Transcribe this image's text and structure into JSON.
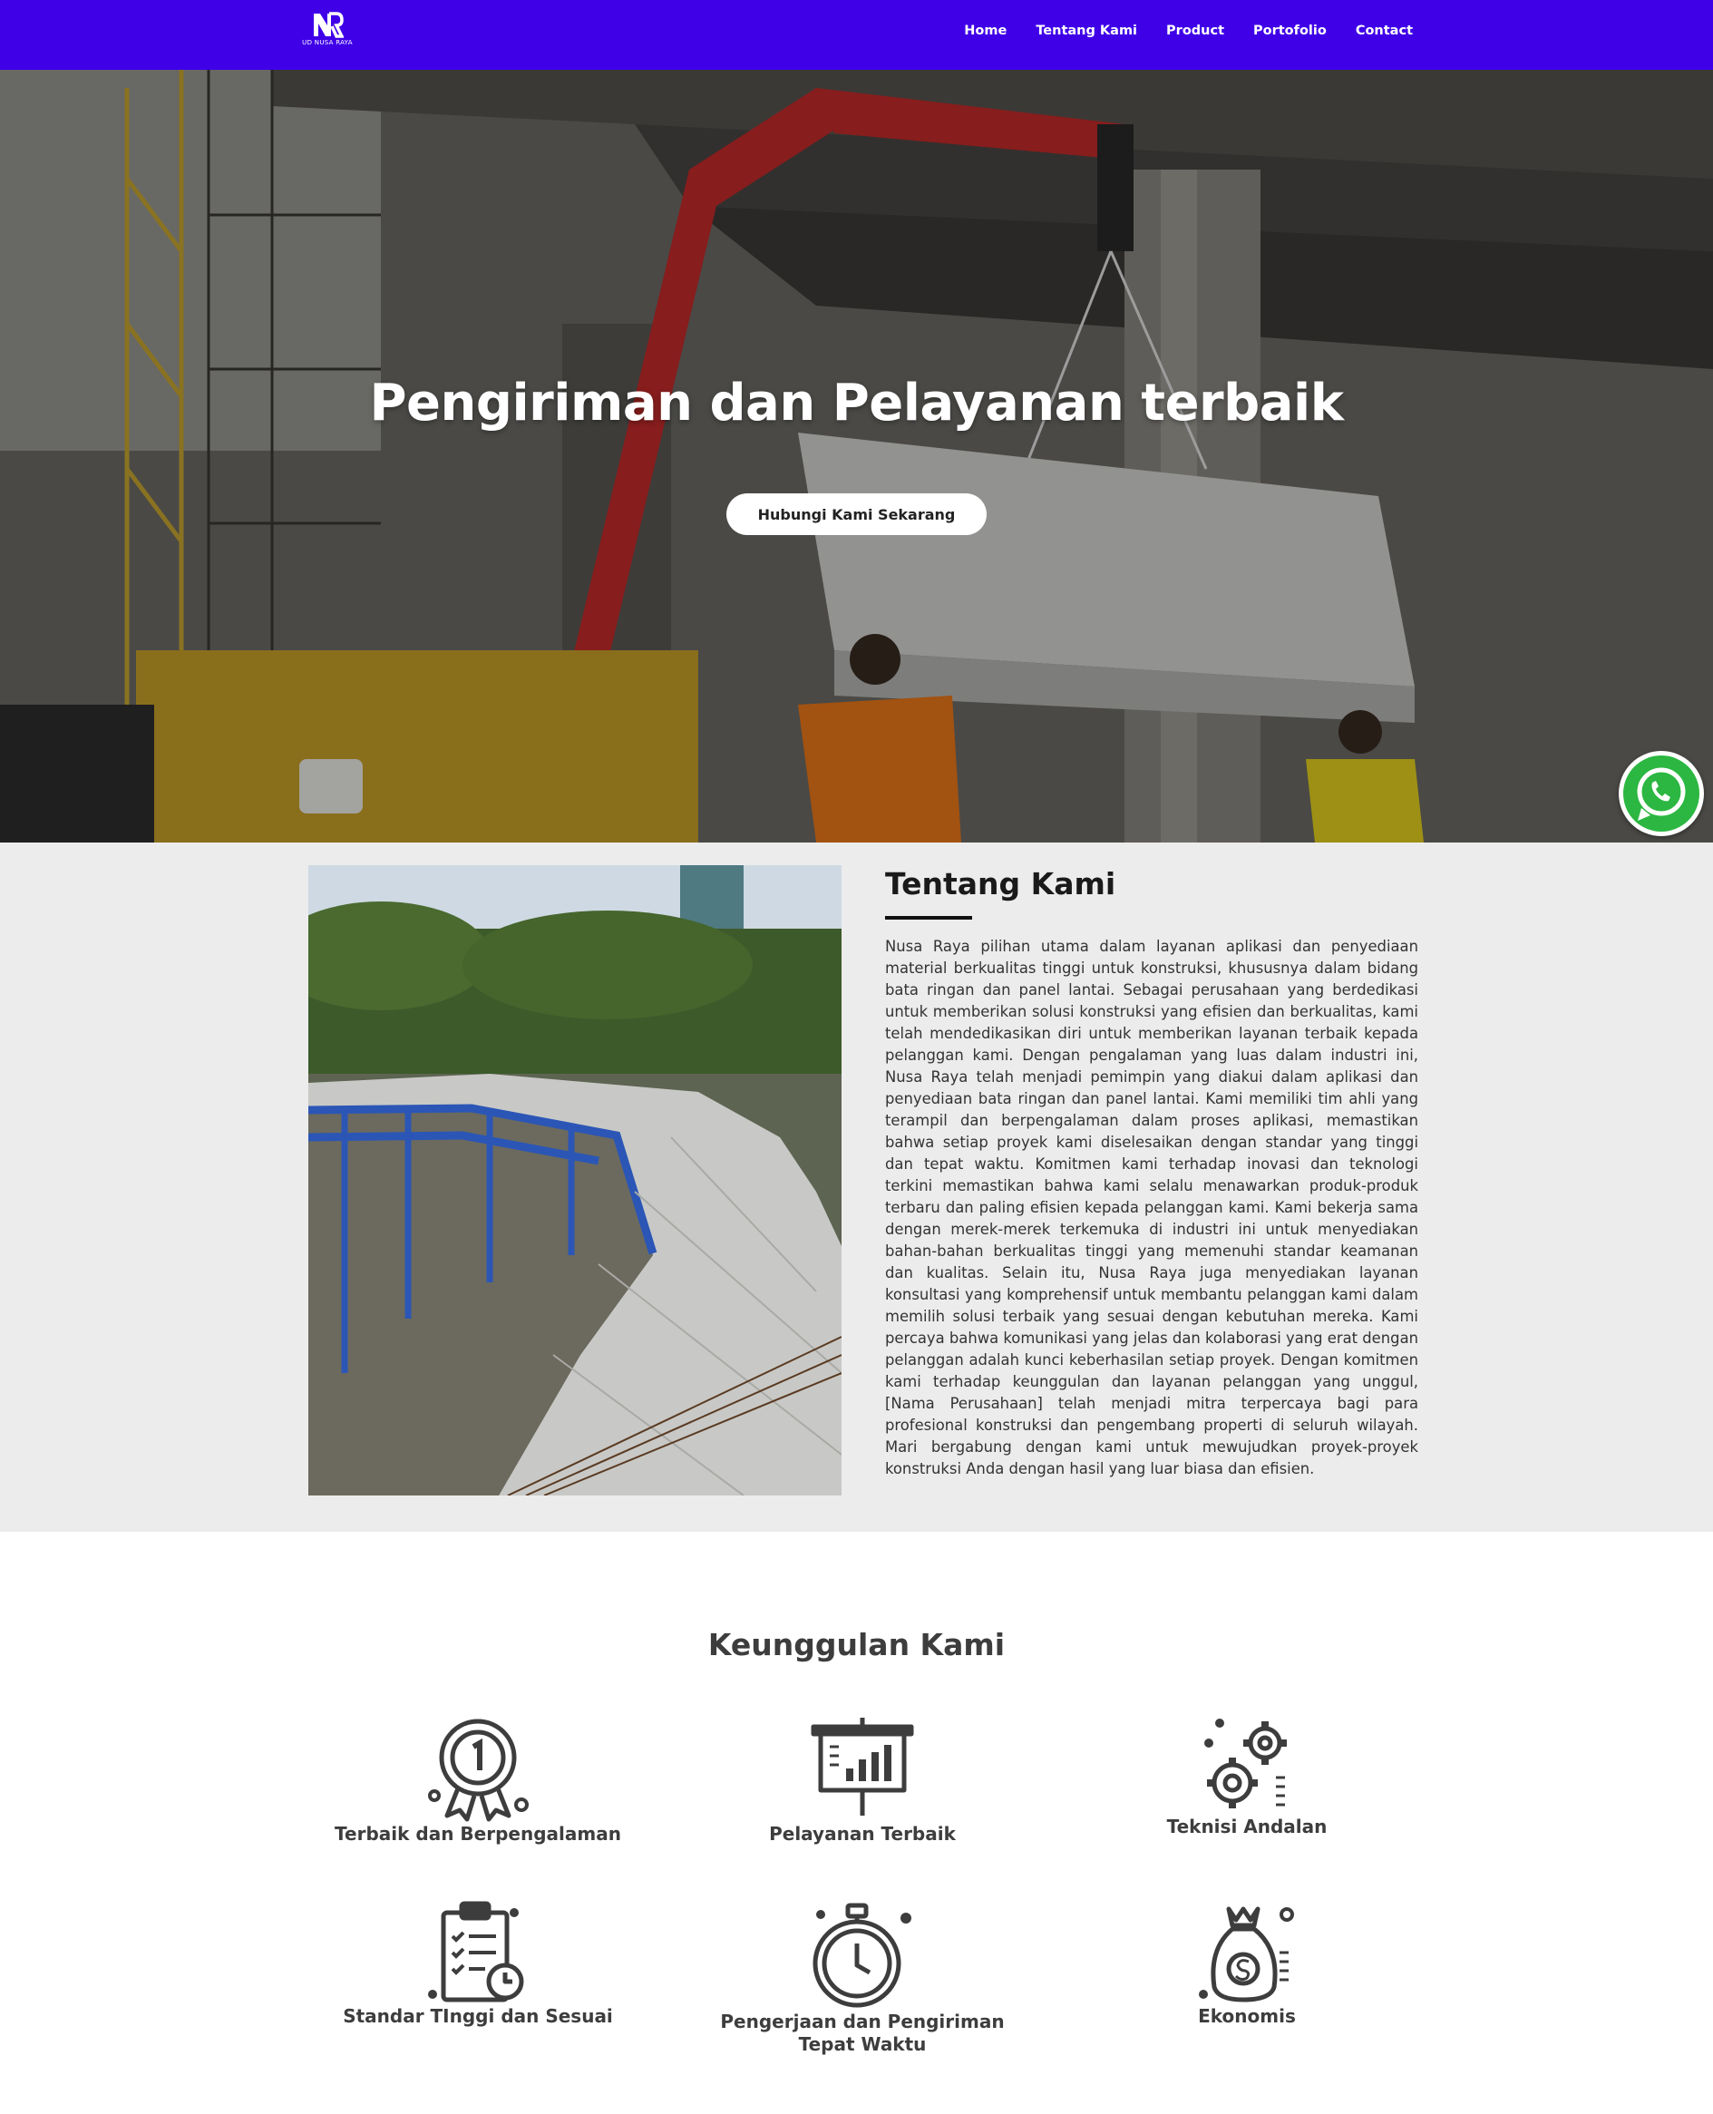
{
  "navbar": {
    "logo_text": "UD NUSA RAYA",
    "items": [
      {
        "label": "Home"
      },
      {
        "label": "Tentang Kami"
      },
      {
        "label": "Product"
      },
      {
        "label": "Portofolio"
      },
      {
        "label": "Contact"
      }
    ],
    "background": "#3f00e8"
  },
  "hero": {
    "title": "Pengiriman dan Pelayanan terbaik",
    "cta_label": "Hubungi Kami Sekarang"
  },
  "whatsapp": {
    "icon": "whatsapp-icon",
    "color": "#2bb741"
  },
  "about": {
    "title": "Tentang Kami",
    "body": "Nusa Raya pilihan utama dalam layanan aplikasi dan penyediaan material berkualitas tinggi untuk konstruksi, khususnya dalam bidang bata ringan dan panel lantai. Sebagai perusahaan yang berdedikasi untuk memberikan solusi konstruksi yang efisien dan berkualitas, kami telah mendedikasikan diri untuk memberikan layanan terbaik kepada pelanggan kami. Dengan pengalaman yang luas dalam industri ini, Nusa Raya telah menjadi pemimpin yang diakui dalam aplikasi dan penyediaan bata ringan dan panel lantai. Kami memiliki tim ahli yang terampil dan berpengalaman dalam proses aplikasi, memastikan bahwa setiap proyek kami diselesaikan dengan standar yang tinggi dan tepat waktu. Komitmen kami terhadap inovasi dan teknologi terkini memastikan bahwa kami selalu menawarkan produk-produk terbaru dan paling efisien kepada pelanggan kami. Kami bekerja sama dengan merek-merek terkemuka di industri ini untuk menyediakan bahan-bahan berkualitas tinggi yang memenuhi standar keamanan dan kualitas. Selain itu, Nusa Raya juga menyediakan layanan konsultasi yang komprehensif untuk membantu pelanggan kami dalam memilih solusi terbaik yang sesuai dengan kebutuhan mereka. Kami percaya bahwa komunikasi yang jelas dan kolaborasi yang erat dengan pelanggan adalah kunci keberhasilan setiap proyek. Dengan komitmen kami terhadap keunggulan dan layanan pelanggan yang unggul, [Nama Perusahaan] telah menjadi mitra terpercaya bagi para profesional konstruksi dan pengembang properti di seluruh wilayah. Mari bergabung dengan kami untuk mewujudkan proyek-proyek konstruksi Anda dengan hasil yang luar biasa dan efisien."
  },
  "features": {
    "title": "Keunggulan Kami",
    "items": [
      {
        "label": "Terbaik dan Berpengalaman",
        "icon": "award-medal-icon"
      },
      {
        "label": "Pelayanan Terbaik",
        "icon": "presentation-chart-icon"
      },
      {
        "label": "Teknisi Andalan",
        "icon": "gears-icon"
      },
      {
        "label": "Standar TInggi dan Sesuai",
        "icon": "clipboard-checklist-icon"
      },
      {
        "label": "Pengerjaan dan Pengiriman Tepat Waktu",
        "icon": "stopwatch-icon"
      },
      {
        "label": "Ekonomis",
        "icon": "money-bag-icon"
      }
    ]
  }
}
